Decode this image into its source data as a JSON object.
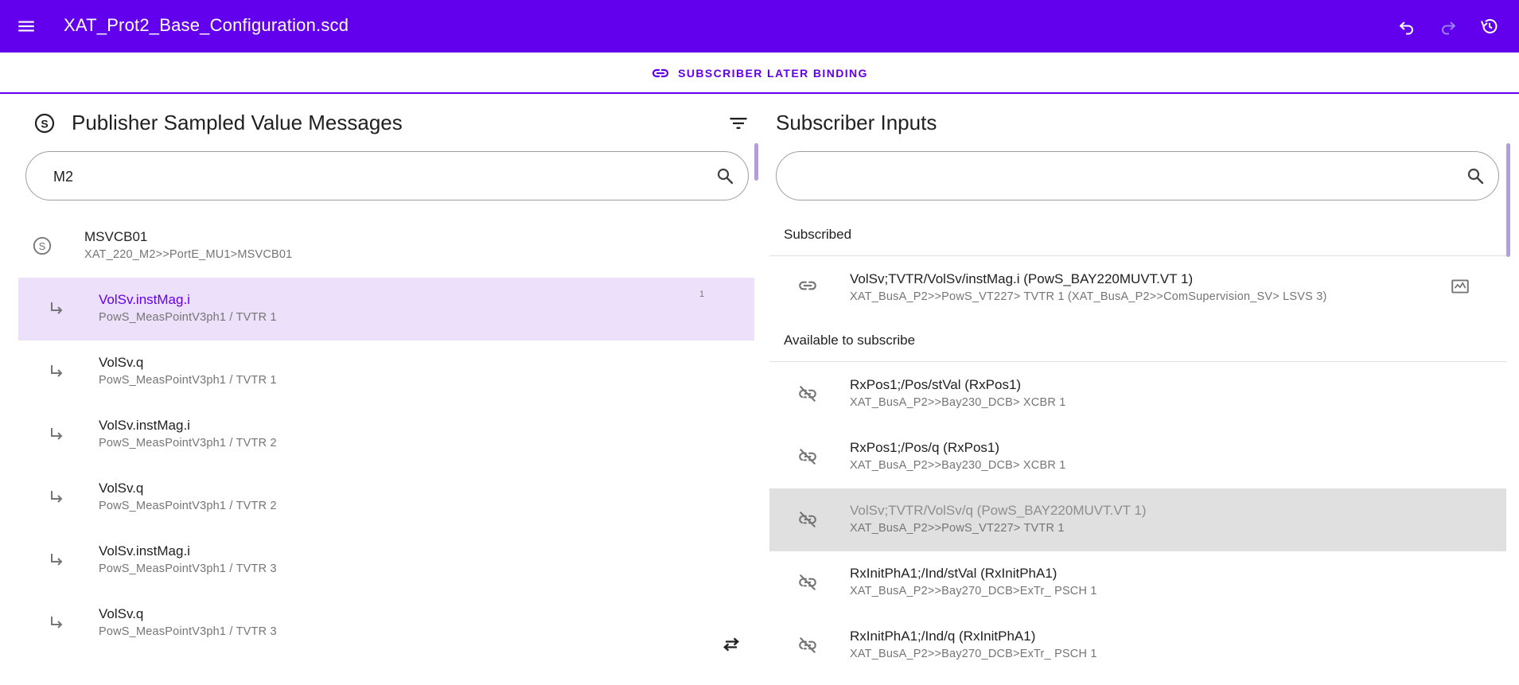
{
  "app": {
    "title": "XAT_Prot2_Base_Configuration.scd",
    "menu_icon": "hamburger-menu-icon",
    "undo_icon": "undo-icon",
    "redo_icon": "redo-icon",
    "history_icon": "history-icon"
  },
  "tab": {
    "label": "SUBSCRIBER LATER BINDING",
    "icon": "link-icon"
  },
  "publisher": {
    "title": "Publisher Sampled Value Messages",
    "search_value": "M2",
    "control_block": {
      "name": "MSVCB01",
      "path": "XAT_220_M2>>PortE_MU1>MSVCB01"
    },
    "items": [
      {
        "name": "VolSv.instMag.i",
        "path": "PowS_MeasPointV3ph1 / TVTR 1",
        "count": "1",
        "selected": true
      },
      {
        "name": "VolSv.q",
        "path": "PowS_MeasPointV3ph1 / TVTR 1",
        "count": "",
        "selected": false
      },
      {
        "name": "VolSv.instMag.i",
        "path": "PowS_MeasPointV3ph1 / TVTR 2",
        "count": "",
        "selected": false
      },
      {
        "name": "VolSv.q",
        "path": "PowS_MeasPointV3ph1 / TVTR 2",
        "count": "",
        "selected": false
      },
      {
        "name": "VolSv.instMag.i",
        "path": "PowS_MeasPointV3ph1 / TVTR 3",
        "count": "",
        "selected": false
      },
      {
        "name": "VolSv.q",
        "path": "PowS_MeasPointV3ph1 / TVTR 3",
        "count": "",
        "selected": false
      }
    ]
  },
  "subscriber": {
    "title": "Subscriber Inputs",
    "search_value": "",
    "subscribed_header": "Subscribed",
    "available_header": "Available to subscribe",
    "subscribed": [
      {
        "name": "VolSv;TVTR/VolSv/instMag.i (PowS_BAY220MUVT.VT 1)",
        "path": "XAT_BusA_P2>>PowS_VT227> TVTR 1 (XAT_BusA_P2>>ComSupervision_SV> LSVS 3)"
      }
    ],
    "available": [
      {
        "name": "RxPos1;/Pos/stVal (RxPos1)",
        "path": "XAT_BusA_P2>>Bay230_DCB> XCBR 1",
        "disabled": false
      },
      {
        "name": "RxPos1;/Pos/q (RxPos1)",
        "path": "XAT_BusA_P2>>Bay230_DCB> XCBR 1",
        "disabled": false
      },
      {
        "name": "VolSv;TVTR/VolSv/q (PowS_BAY220MUVT.VT 1)",
        "path": "XAT_BusA_P2>>PowS_VT227> TVTR 1",
        "disabled": true
      },
      {
        "name": "RxInitPhA1;/Ind/stVal (RxInitPhA1)",
        "path": "XAT_BusA_P2>>Bay270_DCB>ExTr_ PSCH 1",
        "disabled": false
      },
      {
        "name": "RxInitPhA1;/Ind/q (RxInitPhA1)",
        "path": "XAT_BusA_P2>>Bay270_DCB>ExTr_ PSCH 1",
        "disabled": false
      }
    ]
  },
  "colors": {
    "primary": "#6200ee",
    "selected_row_bg": "#ede0fb",
    "disabled_row_bg": "#e0e0e0",
    "scrollbar": "#b39ddb"
  }
}
